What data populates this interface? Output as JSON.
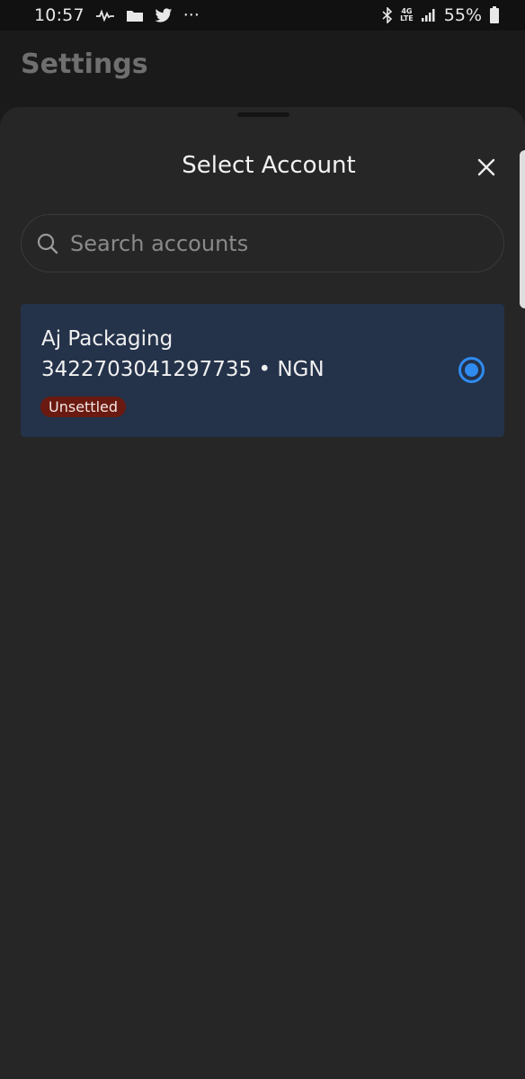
{
  "status_bar": {
    "time": "10:57",
    "network_label": "4G",
    "lte_label": "LTE",
    "battery_percent": "55%",
    "more_label": "···",
    "icons": [
      "activity-icon",
      "folder-icon",
      "twitter-icon",
      "more-icon",
      "bluetooth-icon",
      "signal-icon",
      "battery-icon"
    ]
  },
  "header": {
    "title": "Settings"
  },
  "sheet": {
    "title": "Select Account",
    "search": {
      "placeholder": "Search accounts",
      "value": ""
    },
    "accounts": [
      {
        "name": "Aj Packaging",
        "details": "3422703041297735 • NGN",
        "status": "Unsettled",
        "selected": true
      }
    ]
  },
  "colors": {
    "background": "#1a1a1a",
    "sheet": "#262626",
    "card": "#24324a",
    "accent": "#2f8bf0",
    "badge": "#6a1a10"
  }
}
